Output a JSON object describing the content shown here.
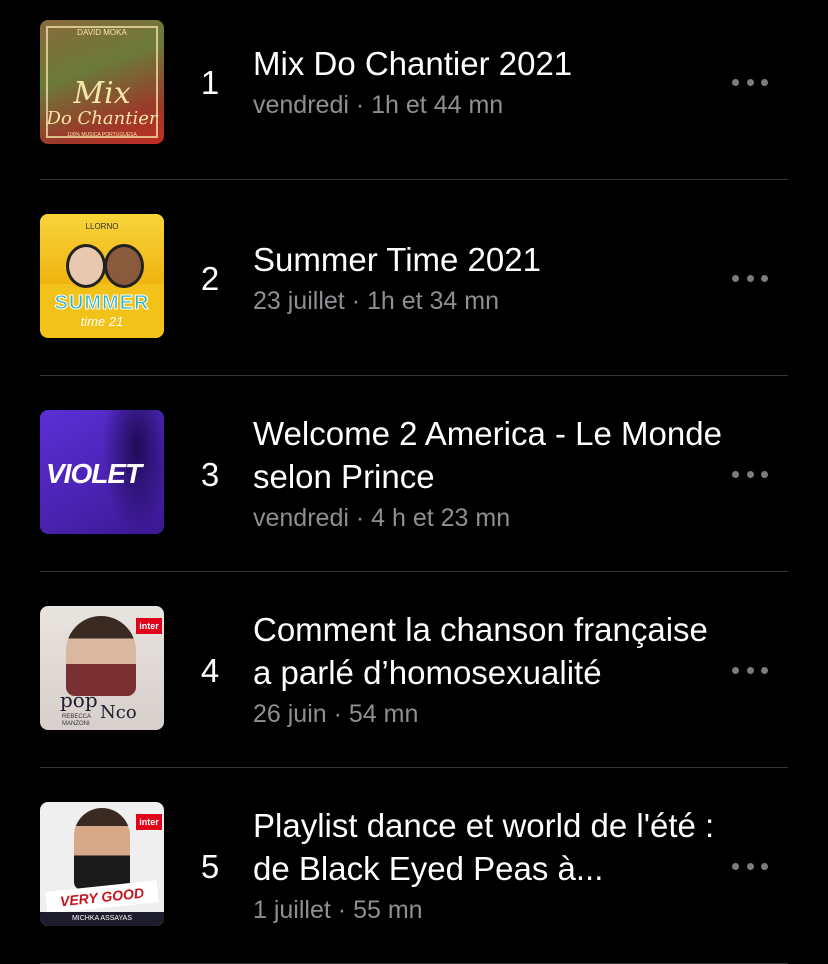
{
  "episodes": [
    {
      "rank": "1",
      "title": "Mix Do Chantier 2021",
      "date": "vendredi",
      "separator": "·",
      "duration": "1h et 44 mn",
      "artwork": {
        "top": "DAVID MOKA",
        "main1": "Mix",
        "main2": "Do Chantier",
        "bottom": "100% MUSICA PORTUGUESA"
      }
    },
    {
      "rank": "2",
      "title": "Summer Time 2021",
      "date": "23 juillet",
      "separator": "·",
      "duration": "1h et 34 mn",
      "artwork": {
        "top": "LLORNO",
        "main": "SUMMER",
        "sub": "time 21"
      }
    },
    {
      "rank": "3",
      "title": "Welcome 2 America - Le Monde selon Prince",
      "date": "vendredi",
      "separator": "·",
      "duration": "4 h et 23 mn",
      "artwork": {
        "word": "VIOLET"
      }
    },
    {
      "rank": "4",
      "title": "Comment la chanson française a parlé d’homosexualité",
      "date": "26 juin",
      "separator": "·",
      "duration": "54 mn",
      "artwork": {
        "badge": "inter",
        "logo1": "pop",
        "logo2": "Nco",
        "host1": "REBECCA",
        "host2": "MANZONI"
      }
    },
    {
      "rank": "5",
      "title": "Playlist dance et world de l'été : de Black Eyed Peas à...",
      "date": "1 juillet",
      "separator": "·",
      "duration": "55 mn",
      "artwork": {
        "badge": "inter",
        "strip": "VERY GOOD TRIP",
        "host": "MICHKA ASSAYAS"
      }
    }
  ],
  "colors": {
    "background": "#000000",
    "title": "#ffffff",
    "meta": "#8e8e93",
    "divider": "#333333",
    "more": "#7c7c80"
  },
  "icons": {
    "more": "ellipsis-horizontal-icon"
  }
}
